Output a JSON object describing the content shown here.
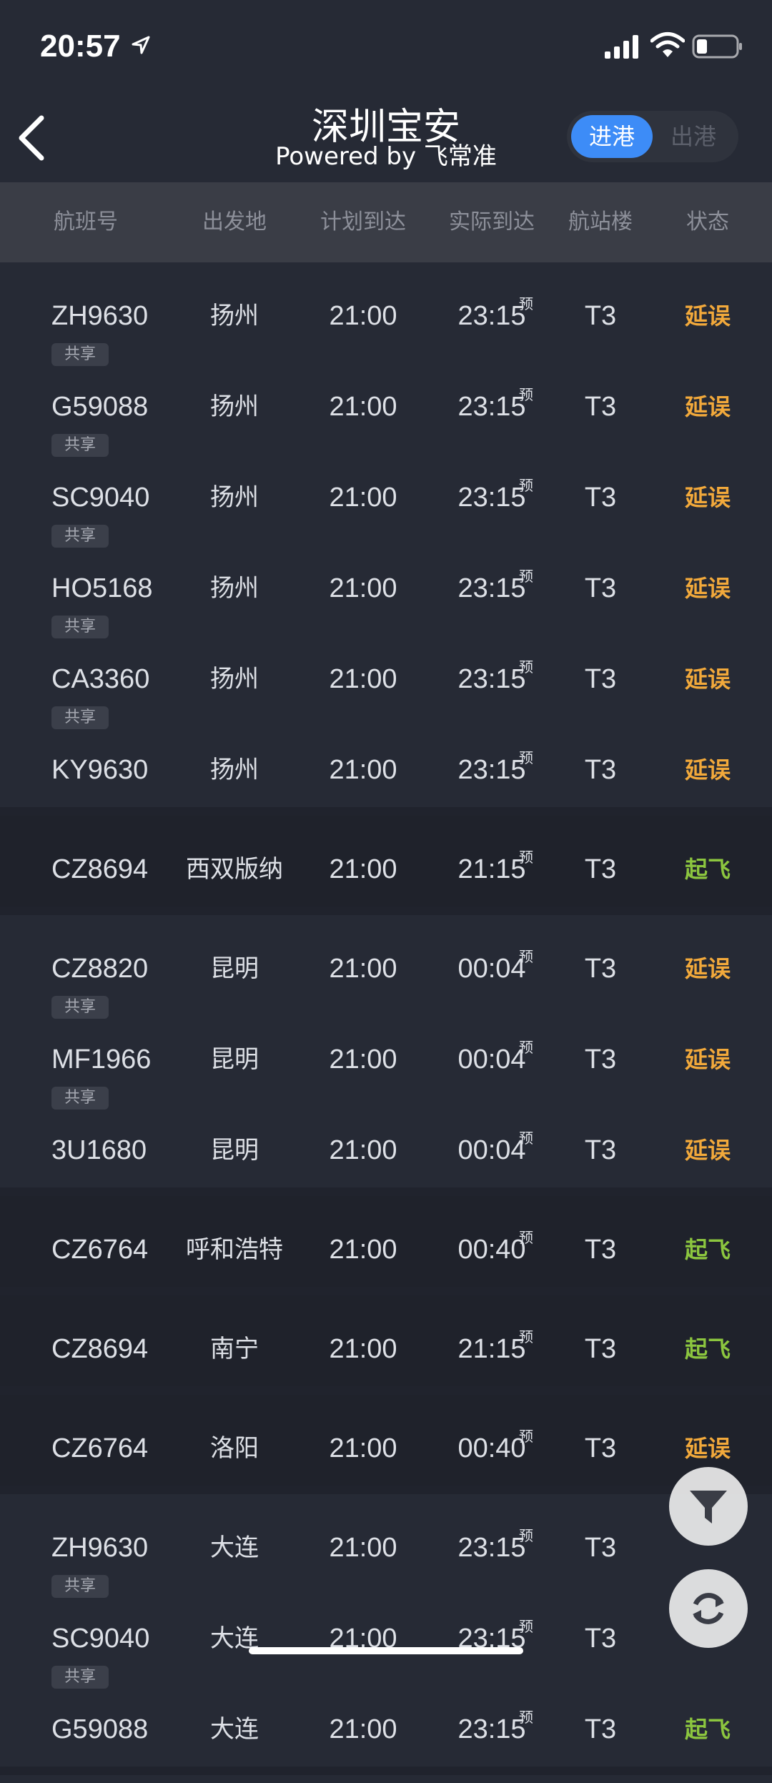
{
  "status_bar": {
    "time": "20:57"
  },
  "header": {
    "title": "深圳宝安",
    "subtitle": "Powered by 飞常准",
    "toggle": {
      "arrivals": "进港",
      "departures": "出港"
    }
  },
  "columns": [
    "航班号",
    "出发地",
    "计划到达",
    "实际到达",
    "航站楼",
    "状态"
  ],
  "labels": {
    "shared": "共享",
    "estimated": "预"
  },
  "groups": [
    {
      "rows": [
        {
          "flight": "ZH9630",
          "origin": "扬州",
          "scheduled": "21:00",
          "actual": "23:15",
          "terminal": "T3",
          "status": "延误",
          "shared": false
        },
        {
          "flight": "G59088",
          "origin": "扬州",
          "scheduled": "21:00",
          "actual": "23:15",
          "terminal": "T3",
          "status": "延误",
          "shared": true
        },
        {
          "flight": "SC9040",
          "origin": "扬州",
          "scheduled": "21:00",
          "actual": "23:15",
          "terminal": "T3",
          "status": "延误",
          "shared": true
        },
        {
          "flight": "HO5168",
          "origin": "扬州",
          "scheduled": "21:00",
          "actual": "23:15",
          "terminal": "T3",
          "status": "延误",
          "shared": true
        },
        {
          "flight": "CA3360",
          "origin": "扬州",
          "scheduled": "21:00",
          "actual": "23:15",
          "terminal": "T3",
          "status": "延误",
          "shared": true
        },
        {
          "flight": "KY9630",
          "origin": "扬州",
          "scheduled": "21:00",
          "actual": "23:15",
          "terminal": "T3",
          "status": "延误",
          "shared": true
        }
      ]
    },
    {
      "rows": [
        {
          "flight": "CZ8694",
          "origin": "西双版纳",
          "scheduled": "21:00",
          "actual": "21:15",
          "terminal": "T3",
          "status": "起飞",
          "shared": false
        }
      ]
    },
    {
      "rows": [
        {
          "flight": "CZ8820",
          "origin": "昆明",
          "scheduled": "21:00",
          "actual": "00:04",
          "terminal": "T3",
          "status": "延误",
          "shared": false
        },
        {
          "flight": "MF1966",
          "origin": "昆明",
          "scheduled": "21:00",
          "actual": "00:04",
          "terminal": "T3",
          "status": "延误",
          "shared": true
        },
        {
          "flight": "3U1680",
          "origin": "昆明",
          "scheduled": "21:00",
          "actual": "00:04",
          "terminal": "T3",
          "status": "延误",
          "shared": true
        }
      ]
    },
    {
      "rows": [
        {
          "flight": "CZ6764",
          "origin": "呼和浩特",
          "scheduled": "21:00",
          "actual": "00:40",
          "terminal": "T3",
          "status": "起飞",
          "shared": false
        }
      ]
    },
    {
      "rows": [
        {
          "flight": "CZ8694",
          "origin": "南宁",
          "scheduled": "21:00",
          "actual": "21:15",
          "terminal": "T3",
          "status": "起飞",
          "shared": false
        }
      ]
    },
    {
      "rows": [
        {
          "flight": "CZ6764",
          "origin": "洛阳",
          "scheduled": "21:00",
          "actual": "00:40",
          "terminal": "T3",
          "status": "延误",
          "shared": false
        }
      ]
    },
    {
      "rows": [
        {
          "flight": "ZH9630",
          "origin": "大连",
          "scheduled": "21:00",
          "actual": "23:15",
          "terminal": "T3",
          "status": "",
          "shared": false
        },
        {
          "flight": "SC9040",
          "origin": "大连",
          "scheduled": "21:00",
          "actual": "23:15",
          "terminal": "T3",
          "status": "",
          "shared": true
        },
        {
          "flight": "G59088",
          "origin": "大连",
          "scheduled": "21:00",
          "actual": "23:15",
          "terminal": "T3",
          "status": "起飞",
          "shared": true
        }
      ]
    }
  ],
  "colors": {
    "background": "#262a35",
    "accent": "#3d8cf7",
    "delayed": "#f2a93b",
    "departed": "#8cc63f"
  },
  "icons": {
    "back": "back-arrow-icon",
    "filter": "filter-icon",
    "refresh": "refresh-icon"
  }
}
